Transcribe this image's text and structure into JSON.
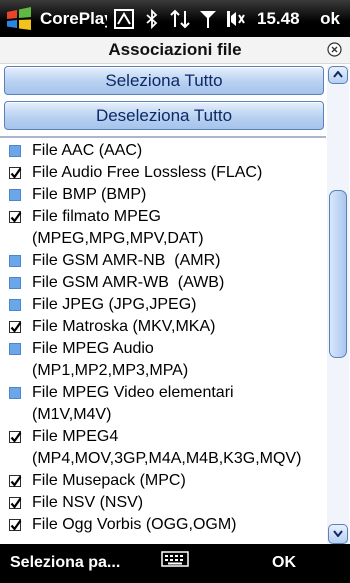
{
  "status_bar": {
    "app_title": "CorePlayer",
    "time": "15.48",
    "ok_label": "ok",
    "icons": [
      "windows-start-icon",
      "connection-icon",
      "bluetooth-icon",
      "data-sync-icon",
      "signal-icon",
      "volume-icon"
    ]
  },
  "dialog": {
    "title": "Associazioni file",
    "select_all": "Seleziona Tutto",
    "deselect_all": "Deseleziona Tutto"
  },
  "items": [
    {
      "label": "File AAC (AAC)",
      "checked": false
    },
    {
      "label": "File Audio Free Lossless (FLAC)",
      "checked": true
    },
    {
      "label": "File BMP (BMP)",
      "checked": false
    },
    {
      "label": "File filmato MPEG\n(MPEG,MPG,MPV,DAT)",
      "checked": true
    },
    {
      "label": "File GSM AMR-NB  (AMR)",
      "checked": false
    },
    {
      "label": "File GSM AMR-WB  (AWB)",
      "checked": false
    },
    {
      "label": "File JPEG (JPG,JPEG)",
      "checked": false
    },
    {
      "label": "File Matroska (MKV,MKA)",
      "checked": true
    },
    {
      "label": "File MPEG Audio\n(MP1,MP2,MP3,MPA)",
      "checked": false
    },
    {
      "label": "File MPEG Video elementari\n(M1V,M4V)",
      "checked": false
    },
    {
      "label": "File MPEG4\n(MP4,MOV,3GP,M4A,M4B,K3G,MQV)",
      "checked": true
    },
    {
      "label": "File Musepack (MPC)",
      "checked": true
    },
    {
      "label": "File NSV (NSV)",
      "checked": true
    },
    {
      "label": "File Ogg Vorbis (OGG,OGM)",
      "checked": true
    }
  ],
  "softkeys": {
    "left": "Seleziona pa...",
    "right": "OK"
  },
  "colors": {
    "button_text": "#0d2a66",
    "unchecked_box": "#6aa6e8",
    "button_border": "#5a82b8"
  }
}
